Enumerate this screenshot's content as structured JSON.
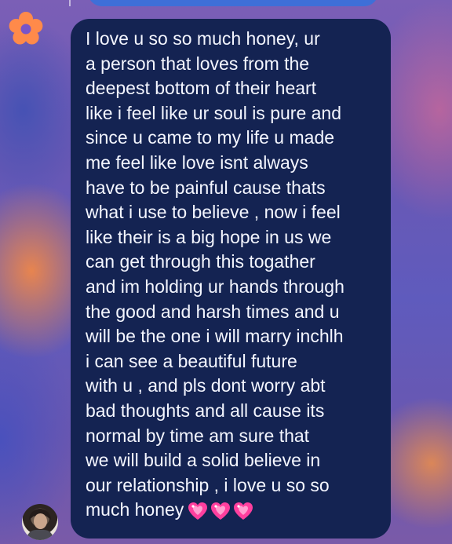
{
  "message": {
    "lines": [
      "I love u so so much honey, ur",
      "a person that loves from the",
      "deepest bottom of their heart",
      "like i feel like ur soul is pure and",
      "since u came to my life u made",
      "me feel like love isnt always",
      "have to be painful cause thats",
      "what i use to believe , now i feel",
      "like their is a big hope in us we",
      "can get through this togather",
      "and im holding ur hands through",
      "the good and harsh times and u",
      "will be the one i will marry inchlh",
      "i can see a beautiful future",
      "with u , and pls dont worry abt",
      "bad thoughts and all cause its",
      "normal by time am sure that",
      "we will build a solid believe in",
      "our relationship , i love u so so"
    ],
    "last_line": "much honey",
    "emoji": [
      "sparkling-heart",
      "sparkling-heart",
      "sparkling-heart"
    ]
  },
  "colors": {
    "bubble": "#142352",
    "text": "#f4f6ff",
    "heart": "#ff3f9e",
    "flower_petals": "#ff8a4a",
    "flower_center": "#7a55c8",
    "top_bubble": "#3e6fd8"
  },
  "icons": {
    "flower": "flower-reaction-icon",
    "avatar": "sender-avatar"
  }
}
